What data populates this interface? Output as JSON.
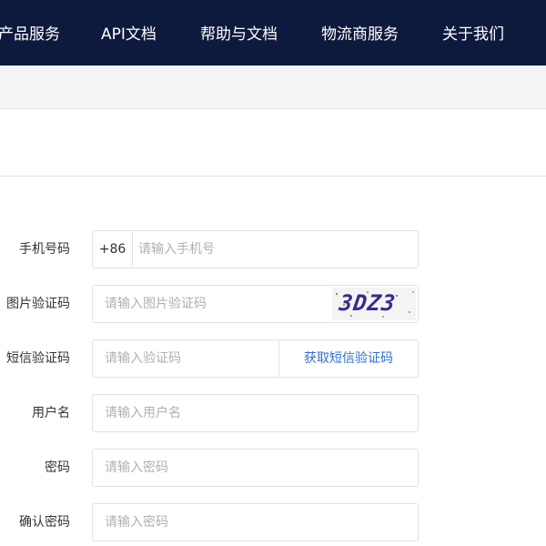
{
  "nav": {
    "items": [
      {
        "label": "产品服务"
      },
      {
        "label": "API文档"
      },
      {
        "label": "帮助与文档"
      },
      {
        "label": "物流商服务"
      },
      {
        "label": "关于我们"
      }
    ]
  },
  "form": {
    "phone": {
      "label": "手机号码",
      "prefix": "+86",
      "placeholder": "请输入手机号"
    },
    "image_code": {
      "label": "图片验证码",
      "placeholder": "请输入图片验证码",
      "captcha_text": "3DZ3"
    },
    "sms_code": {
      "label": "短信验证码",
      "placeholder": "请输入验证码",
      "button": "获取短信验证码"
    },
    "username": {
      "label": "用户名",
      "placeholder": "请输入用户名"
    },
    "password": {
      "label": "密码",
      "placeholder": "请输入密码"
    },
    "confirm_password": {
      "label": "确认密码",
      "placeholder": "请输入密码"
    }
  },
  "colors": {
    "nav_bg": "#0e1a3d",
    "link": "#2f6fd6",
    "captcha": "#3a2a8c"
  }
}
